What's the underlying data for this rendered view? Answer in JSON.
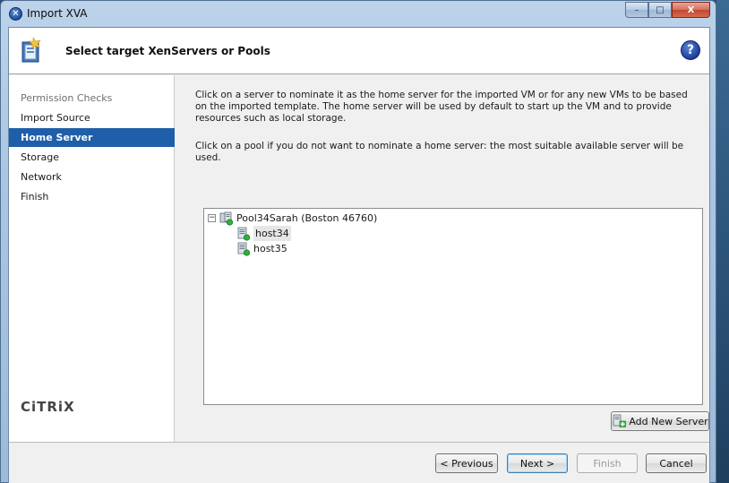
{
  "window": {
    "title": "Import XVA",
    "minimize_glyph": "–",
    "maximize_glyph": "□",
    "close_glyph": "X"
  },
  "header": {
    "title": "Select target XenServers or Pools",
    "help_glyph": "?"
  },
  "sidebar": {
    "items": [
      {
        "label": "Permission Checks",
        "state": "muted"
      },
      {
        "label": "Import Source",
        "state": "normal"
      },
      {
        "label": "Home Server",
        "state": "active"
      },
      {
        "label": "Storage",
        "state": "normal"
      },
      {
        "label": "Network",
        "state": "normal"
      },
      {
        "label": "Finish",
        "state": "normal"
      }
    ],
    "logo": "CiTRiX"
  },
  "content": {
    "para1": "Click on a server to nominate it as the home server for the imported VM or for any new VMs to be based on the imported template. The home server will be used by default to start up the VM and to provide resources such as local storage.",
    "para2": "Click on a pool if you do not want to nominate a home server: the most suitable available server will be used.",
    "tree": {
      "pool": {
        "label": "Pool34Sarah (Boston 46760)",
        "expander": "⊟"
      },
      "hosts": [
        {
          "label": "host34",
          "selected": true
        },
        {
          "label": "host35",
          "selected": false
        }
      ]
    },
    "add_server_label": "Add New Server"
  },
  "footer": {
    "previous_label": "< Previous",
    "next_label": "Next >",
    "finish_label": "Finish",
    "cancel_label": "Cancel"
  },
  "colors": {
    "active_nav": "#1f5ea8",
    "status_green": "#2db23a"
  }
}
